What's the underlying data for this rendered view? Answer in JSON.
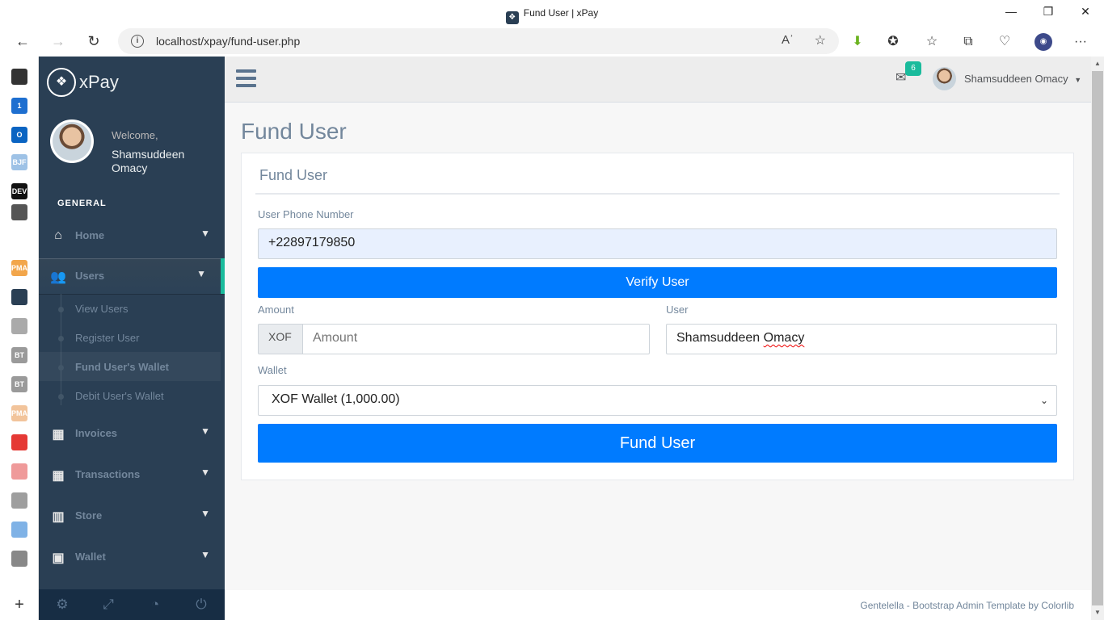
{
  "browser": {
    "tab_title": "Fund User | xPay",
    "url": "localhost/xpay/fund-user.php",
    "minimize": "—",
    "restore": "❐",
    "close": "✕",
    "back": "←",
    "forward": "→",
    "reload": "↻",
    "read_aloud": "Aʾ",
    "favorite": "☆",
    "menu": "···"
  },
  "edge_sidebar": [
    {
      "label": "",
      "color": "#333333"
    },
    {
      "label": "1",
      "color": "#1e6fd0"
    },
    {
      "label": "O",
      "color": "#0a64c2"
    },
    {
      "label": "BJF",
      "color": "#9ec2e6"
    },
    {
      "label": "DEV",
      "color": "#111111"
    },
    {
      "label": "",
      "color": "#555555"
    },
    {
      "label": "PMA",
      "color": "#f2a64b"
    },
    {
      "label": "",
      "color": "#2A3F54"
    },
    {
      "label": "",
      "color": "#aaaaaa"
    },
    {
      "label": "BT",
      "color": "#9a9a9a"
    },
    {
      "label": "BT",
      "color": "#9a9a9a"
    },
    {
      "label": "PMA",
      "color": "#f2c49b"
    },
    {
      "label": "",
      "color": "#e53935"
    },
    {
      "label": "",
      "color": "#ef9a9a"
    },
    {
      "label": "",
      "color": "#9e9e9e"
    },
    {
      "label": "",
      "color": "#7fb2e6"
    },
    {
      "label": "",
      "color": "#888888"
    }
  ],
  "sidebar": {
    "brand": "xPay",
    "welcome": "Welcome,",
    "user_name": "Shamsuddeen Omacy",
    "section": "GENERAL",
    "items": [
      {
        "label": "Home"
      },
      {
        "label": "Users"
      },
      {
        "label": "Invoices"
      },
      {
        "label": "Transactions"
      },
      {
        "label": "Store"
      },
      {
        "label": "Wallet"
      }
    ],
    "users_sub": [
      {
        "label": "View Users"
      },
      {
        "label": "Register User"
      },
      {
        "label": "Fund User's Wallet"
      },
      {
        "label": "Debit User's Wallet"
      }
    ]
  },
  "topnav": {
    "mail_count": "6",
    "user_name": "Shamsuddeen Omacy"
  },
  "page": {
    "title": "Fund User",
    "panel_title": "Fund User",
    "phone_label": "User Phone Number",
    "phone_value": "+22897179850",
    "verify_button": "Verify User",
    "amount_label": "Amount",
    "currency_addon": "XOF",
    "amount_placeholder": "Amount",
    "user_label": "User",
    "user_value_first": "Shamsuddeen",
    "user_value_last": "Omacy",
    "wallet_label": "Wallet",
    "wallet_selected": "XOF Wallet (1,000.00)",
    "fund_button": "Fund User"
  },
  "footer": {
    "text": "Gentelella - Bootstrap Admin Template by Colorlib"
  }
}
